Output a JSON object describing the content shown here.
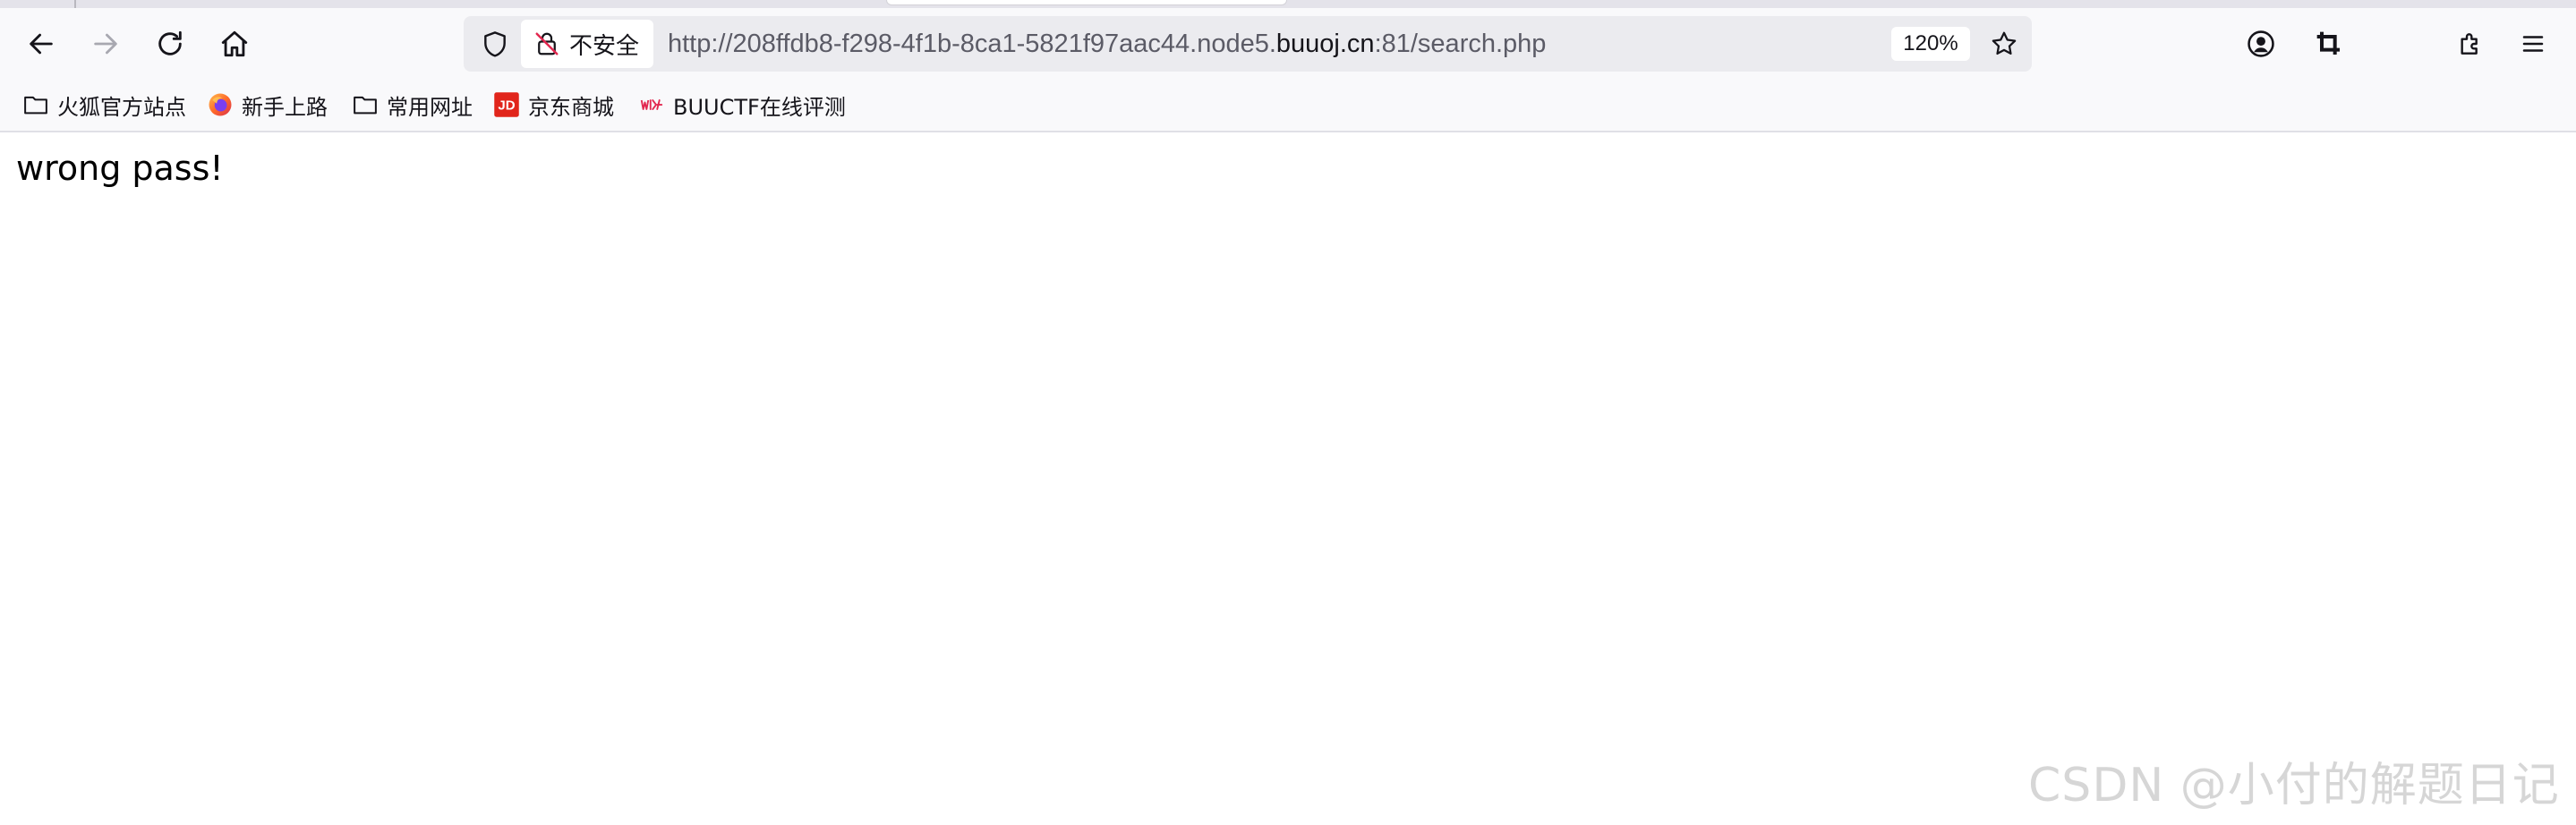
{
  "browser": {
    "url": {
      "prefix": "http://208ffdb8-f298-4f1b-8ca1-5821f97aac44.node5.",
      "domain": "buuoj.cn",
      "suffix": ":81/search.php"
    },
    "security_label": "不安全",
    "zoom": "120%"
  },
  "bookmarks": [
    {
      "label": "火狐官方站点",
      "icon": "folder-icon"
    },
    {
      "label": "新手上路",
      "icon": "firefox-icon"
    },
    {
      "label": "常用网址",
      "icon": "folder-icon"
    },
    {
      "label": "京东商城",
      "icon": "jd-icon"
    },
    {
      "label": "BUUCTF在线评测",
      "icon": "buuctf-icon"
    }
  ],
  "content": {
    "message": "wrong pass!"
  },
  "watermark": "CSDN @小付的解题日记",
  "colors": {
    "toolbar_bg": "#f9f9fb",
    "urlbar_bg": "#ebebef",
    "jd_red": "#e1251b",
    "security_red": "#e22850"
  }
}
